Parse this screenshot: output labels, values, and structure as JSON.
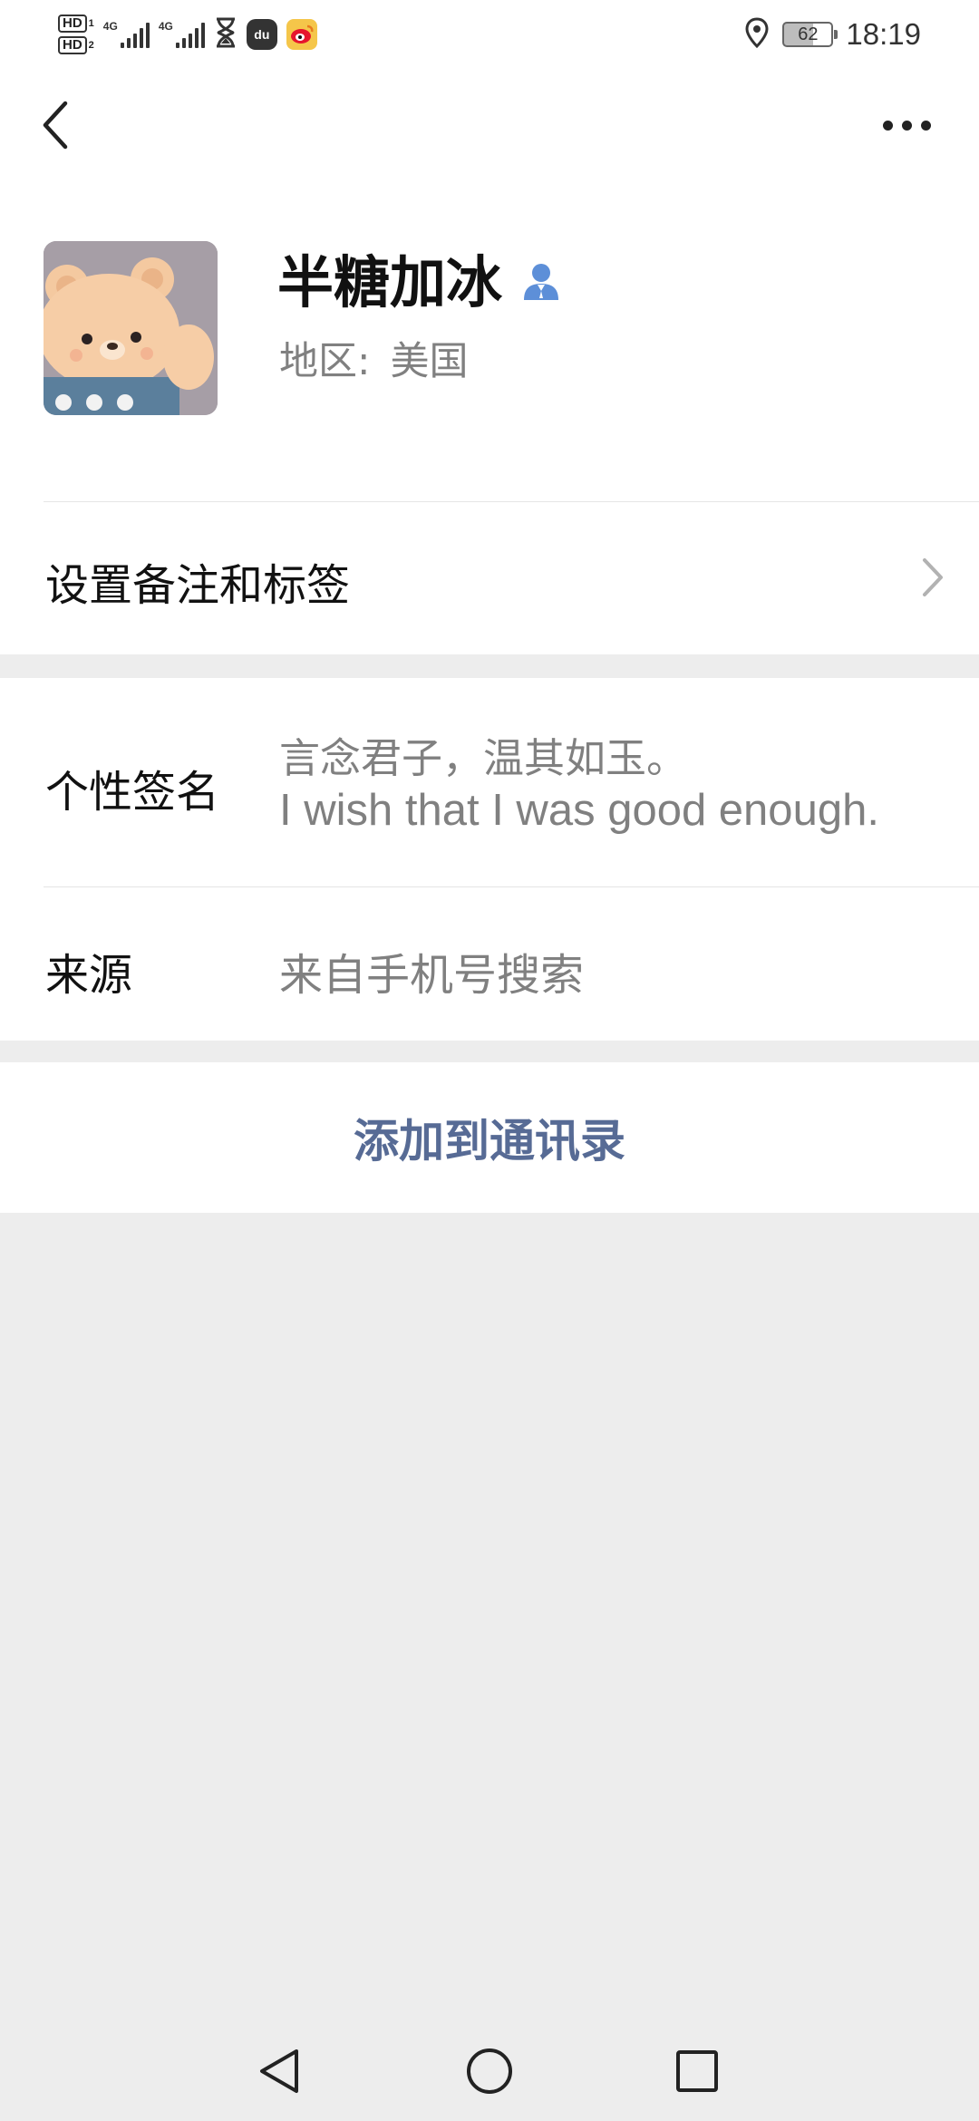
{
  "status_bar": {
    "hd1": "HD",
    "hd1_sub": "1",
    "hd2": "HD",
    "hd2_sub": "2",
    "net1": "4G",
    "net2": "4G",
    "app_icon_du": "du",
    "battery": "62",
    "time": "18:19"
  },
  "icons": {
    "back": "back-arrow-icon",
    "more": "more-dots-icon",
    "verified": "person-badge-icon",
    "chevron": "chevron-right-icon",
    "location": "location-pin-icon",
    "hourglass": "hourglass-icon",
    "weibo": "weibo-icon"
  },
  "profile": {
    "name": "半糖加冰",
    "region_label": "地区:",
    "region_value": "美国"
  },
  "remark_row": {
    "label": "设置备注和标签"
  },
  "signature": {
    "label": "个性签名",
    "line1": "言念君子，温其如玉。",
    "line2": "I wish that I was good enough."
  },
  "source": {
    "label": "来源",
    "value": "来自手机号搜索"
  },
  "action": {
    "add_contact": "添加到通讯录"
  },
  "colors": {
    "link_blue": "#576b95",
    "badge_blue": "#5d8fd8",
    "gray_text": "#808080",
    "page_bg": "#ededed"
  }
}
